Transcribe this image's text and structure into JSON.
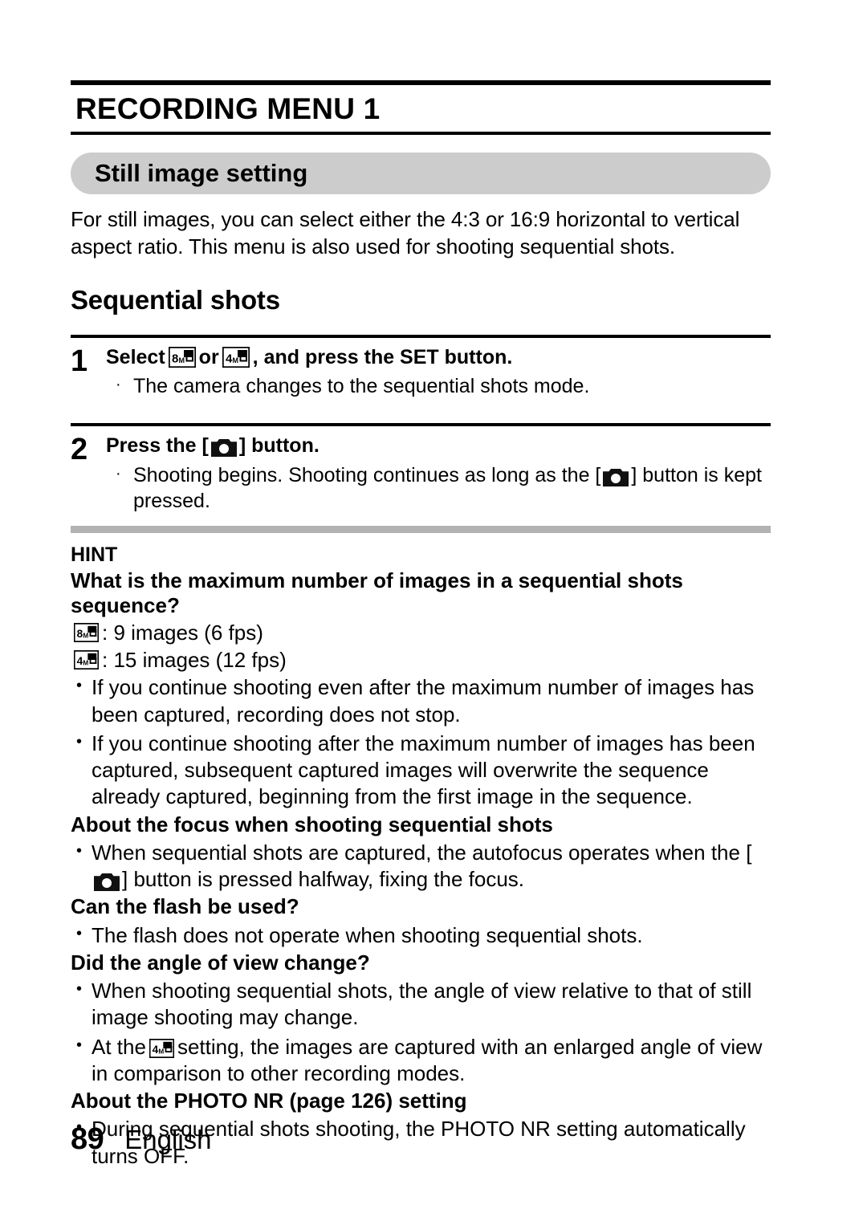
{
  "document": {
    "chapter_title": "RECORDING MENU 1",
    "banner_title": "Still image setting",
    "intro_paragraph": "For still images, you can select either the 4:3 or 16:9 horizontal to vertical aspect ratio. This menu is also used for shooting sequential shots.",
    "section_heading": "Sequential shots"
  },
  "steps": [
    {
      "number": "1",
      "title_before": "Select",
      "icon_a": "8m-sequential-icon",
      "title_middle": "or",
      "icon_b": "4m-sequential-icon",
      "title_after": ", and press the SET button.",
      "bullets": [
        {
          "dot": "·",
          "text": "The camera changes to the sequential shots mode."
        }
      ]
    },
    {
      "number": "2",
      "title_before": "Press the [",
      "icon_a": "camera-shutter-icon",
      "title_after": "] button.",
      "bullets": [
        {
          "dot": "·",
          "text_before": "Shooting begins. Shooting continues as long as the [",
          "icon": "camera-shutter-icon",
          "text_after": "] button is kept pressed."
        }
      ]
    }
  ],
  "hint": {
    "label": "HINT",
    "question_1": "What is the maximum number of images in a sequential shots sequence?",
    "spec_lines": [
      {
        "icon": "8m-sequential-icon",
        "icon_label": "8M",
        "text": ": 9 images (6 fps)"
      },
      {
        "icon": "4m-sequential-icon",
        "icon_label": "4M",
        "text": ": 15 images (12 fps)"
      }
    ],
    "bullets_1": [
      "If you continue shooting even after the maximum number of images has been captured, recording does not stop.",
      "If you continue shooting after the maximum number of images has been captured, subsequent captured images will overwrite the sequence already captured, beginning from the first image in the sequence."
    ],
    "heading_focus": "About the focus when shooting sequential shots",
    "focus_bullet": {
      "text_before": "When sequential shots are captured, the autofocus operates when the [",
      "icon": "camera-shutter-icon",
      "text_after": "] button is pressed halfway, fixing the focus."
    },
    "heading_flash": "Can the flash be used?",
    "flash_bullet": "The flash does not operate when shooting sequential shots.",
    "heading_angle": "Did the angle of view change?",
    "angle_bullet_1": "When shooting sequential shots, the angle of view relative to that of still image shooting may change.",
    "angle_bullet_2": {
      "text_before": "At the",
      "icon": "4m-sequential-icon",
      "text_after": "setting, the images are captured with an enlarged angle of view in comparison to other recording modes."
    },
    "heading_photonr": "About the PHOTO NR (page 126) setting",
    "photonr_bullet": "During sequential shots shooting, the PHOTO NR setting automatically turns OFF.",
    "bullet_glyph": "•"
  },
  "footer": {
    "page_number": "89",
    "language": "English"
  },
  "icons": {
    "camera_shutter": "camera-shutter-icon",
    "res_8m": "8m-sequential-icon",
    "res_4m": "4m-sequential-icon"
  },
  "colors": {
    "banner_gray": "#cccccc",
    "divider_gray": "#b2b2b2",
    "text": "#000000",
    "page_background": "#ffffff"
  }
}
